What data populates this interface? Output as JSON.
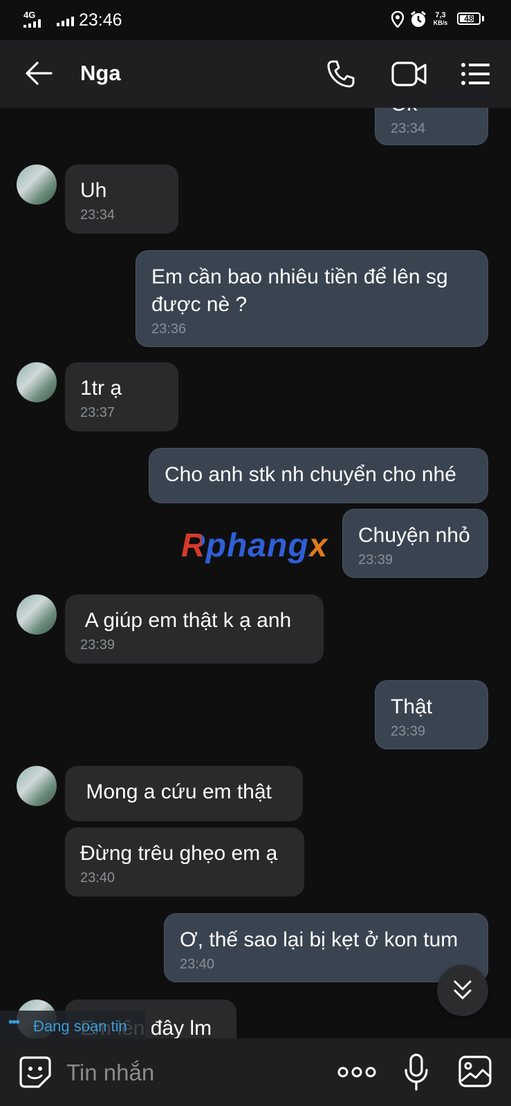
{
  "status_bar": {
    "network": "4G",
    "time": "23:46",
    "speed_value": "7,3",
    "speed_unit": "KB/s",
    "battery": "48"
  },
  "header": {
    "contact_name": "Nga"
  },
  "messages": [
    {
      "side": "out",
      "text": "Ok",
      "time": "23:34"
    },
    {
      "side": "in",
      "text": "Uh",
      "time": "23:34"
    },
    {
      "side": "out",
      "text": "Em cần bao nhiêu tiền để lên sg",
      "text2": "được nè ?",
      "time": "23:36"
    },
    {
      "side": "in",
      "text": "1tr ạ",
      "time": "23:37"
    },
    {
      "side": "out",
      "text": "Cho anh stk nh chuyển cho nhé"
    },
    {
      "side": "out",
      "text": "Chuyện nhỏ",
      "time": "23:39"
    },
    {
      "side": "in",
      "text": " A giúp em thật k ạ anh",
      "time": "23:39"
    },
    {
      "side": "out",
      "text": "Thật",
      "time": "23:39"
    },
    {
      "side": "in",
      "text": " Mong a cứu em thật"
    },
    {
      "side": "in",
      "text": "Đừng trêu ghẹo em ạ",
      "time": "23:40"
    },
    {
      "side": "out",
      "text": "Ơ, thế sao lại bị kẹt ở kon tum",
      "time": "23:40"
    },
    {
      "side": "in",
      "text": "Em lên đây lm"
    }
  ],
  "watermark": "Rphangx",
  "typing_indicator": "Đang soạn tin",
  "composer": {
    "placeholder": "Tin nhắn"
  }
}
